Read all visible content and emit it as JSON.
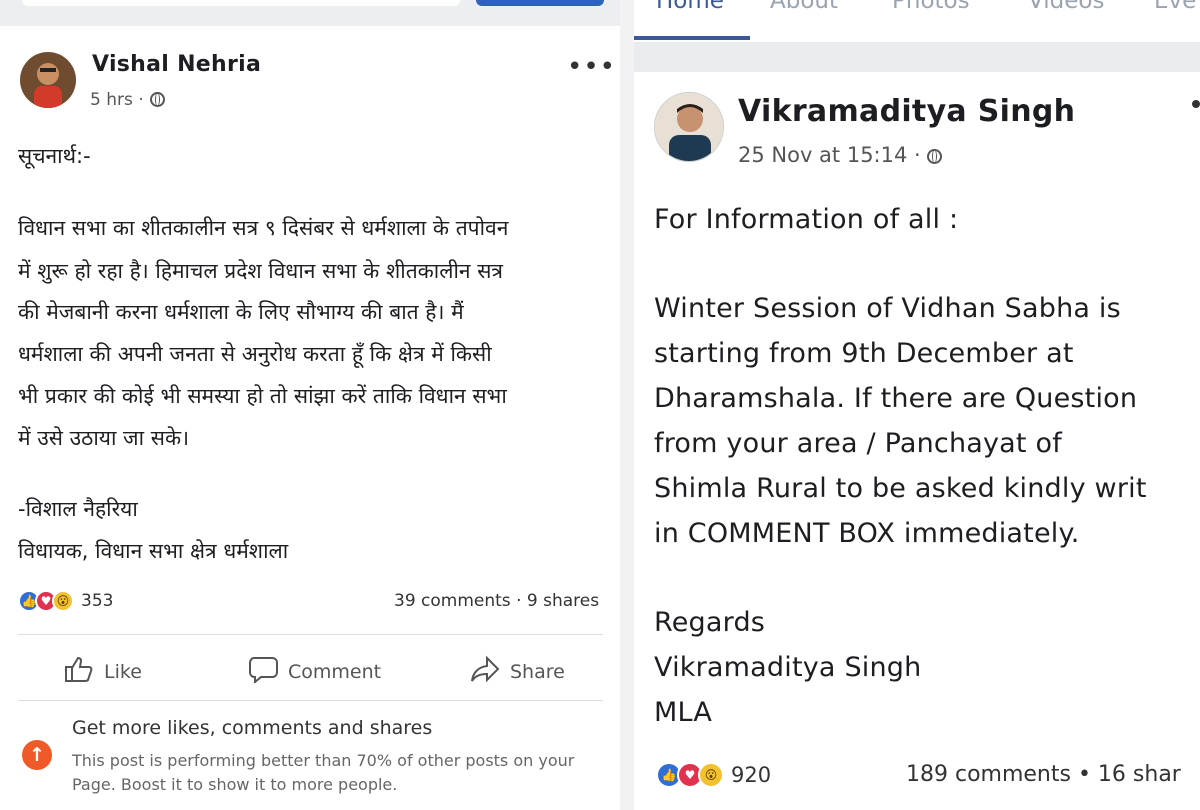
{
  "left_post": {
    "author": "Vishal Nehria",
    "time": "5 hrs ·",
    "more_icon": "ellipsis-icon",
    "lines": [
      "सूचनार्थ:-",
      "विधान सभा का शीतकालीन सत्र ९ दिसंबर से धर्मशाला के तपोवन",
      "में शुरू हो रहा है। हिमाचल प्रदेश विधान सभा के शीतकालीन सत्र",
      "की मेजबानी करना धर्मशाला के लिए सौभाग्य की बात है। मैं",
      "धर्मशाला की अपनी जनता से अनुरोध करता हूँ कि क्षेत्र में किसी",
      "भी प्रकार की कोई भी समस्या हो तो सांझा करें ताकि विधान सभा",
      "में उसे उठाया जा सके।",
      "-विशाल नैहरिया",
      "विधायक, विधान सभा क्षेत्र धर्मशाला"
    ],
    "reaction_count": "353",
    "comments_shares": "39 comments · 9 shares",
    "actions": {
      "like": "Like",
      "comment": "Comment",
      "share": "Share"
    },
    "boost": {
      "title": "Get more likes, comments and shares",
      "text": "This post is performing better than 70% of other posts on your Page. Boost it to show it to more people."
    }
  },
  "right_post": {
    "nav_tabs": [
      "Home",
      "About",
      "Photos",
      "Videos",
      "Eve"
    ],
    "author": "Vikramaditya Singh",
    "time": "25 Nov at 15:14 ·",
    "lines": [
      "For Information of all :",
      "Winter Session of Vidhan Sabha is",
      "starting from 9th December at",
      "Dharamshala. If there are Question",
      "from your area / Panchayat of",
      "Shimla Rural to be asked kindly writ",
      "in COMMENT BOX immediately.",
      "Regards",
      "Vikramaditya Singh",
      "MLA"
    ],
    "reaction_count": "920",
    "comments_shares": "189 comments • 16 shar"
  },
  "colors": {
    "link_blue": "#3b5998",
    "like_blue": "#2e6ed6",
    "love_red": "#e0314f",
    "wow_yellow": "#f2c12e",
    "boost_orange": "#f05a28"
  }
}
